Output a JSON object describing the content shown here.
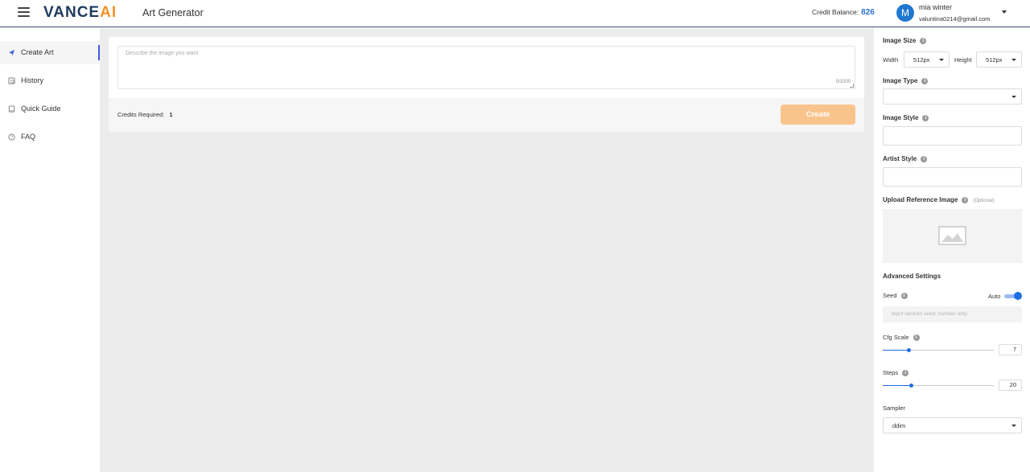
{
  "header": {
    "logo_main": "VANCE",
    "logo_accent": "AI",
    "app_title": "Art Generator",
    "credit_label": "Credit Balance:",
    "credit_value": "826",
    "user": {
      "initial": "M",
      "name": "mia winter",
      "email": "valuntina0214@gmail.com"
    }
  },
  "sidebar": {
    "items": [
      {
        "label": "Create Art",
        "icon": "send-icon",
        "active": true
      },
      {
        "label": "History",
        "icon": "history-icon",
        "active": false
      },
      {
        "label": "Quick Guide",
        "icon": "book-icon",
        "active": false
      },
      {
        "label": "FAQ",
        "icon": "question-icon",
        "active": false
      }
    ]
  },
  "main": {
    "prompt_placeholder": "Describe the image you want",
    "prompt_count": "0/1000",
    "credits_required_label": "Credits Required:",
    "credits_required_value": "1",
    "create_label": "Create"
  },
  "settings": {
    "image_size_label": "Image Size",
    "width_label": "Width",
    "width_value": "512px",
    "height_label": "Height",
    "height_value": "512px",
    "image_type_label": "Image Type",
    "image_type_value": "",
    "image_style_label": "Image Style",
    "artist_style_label": "Artist Style",
    "upload_label": "Upload Reference Image",
    "upload_optional": "(Optional)",
    "advanced_label": "Advanced Settings",
    "seed_label": "Seed",
    "seed_auto_label": "Auto",
    "seed_auto_on": true,
    "seed_placeholder": "Input random seed, number only.",
    "cfg_label": "Cfg Scale",
    "cfg_value": "7",
    "cfg_fraction": 0.23,
    "steps_label": "Steps",
    "steps_value": "20",
    "steps_fraction": 0.25,
    "sampler_label": "Sampler",
    "sampler_value": "ddim"
  },
  "colors": {
    "brand_navy": "#1f3a5f",
    "brand_orange": "#f2922a",
    "accent_blue": "#1f6fe0",
    "create_button": "#f9c48c"
  }
}
